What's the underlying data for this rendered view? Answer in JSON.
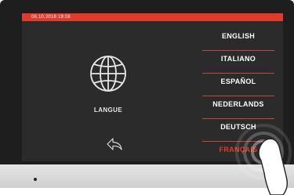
{
  "status_bar": {
    "datetime": "06.10.2018  19:08"
  },
  "main": {
    "title": "LANGUE",
    "globe_icon": "globe-icon",
    "back_icon": "back-arrow-icon"
  },
  "languages": [
    {
      "label": "ENGLISH",
      "active": false
    },
    {
      "label": "ITALIANO",
      "active": false
    },
    {
      "label": "ESPAÑOL",
      "active": false
    },
    {
      "label": "NEDERLANDS",
      "active": false
    },
    {
      "label": "DEUTSCH",
      "active": false
    },
    {
      "label": "FRANÇAIS",
      "active": true
    }
  ],
  "colors": {
    "accent": "#e33a2b",
    "screen_bg": "#2b2b2c",
    "text": "#ffffff"
  }
}
